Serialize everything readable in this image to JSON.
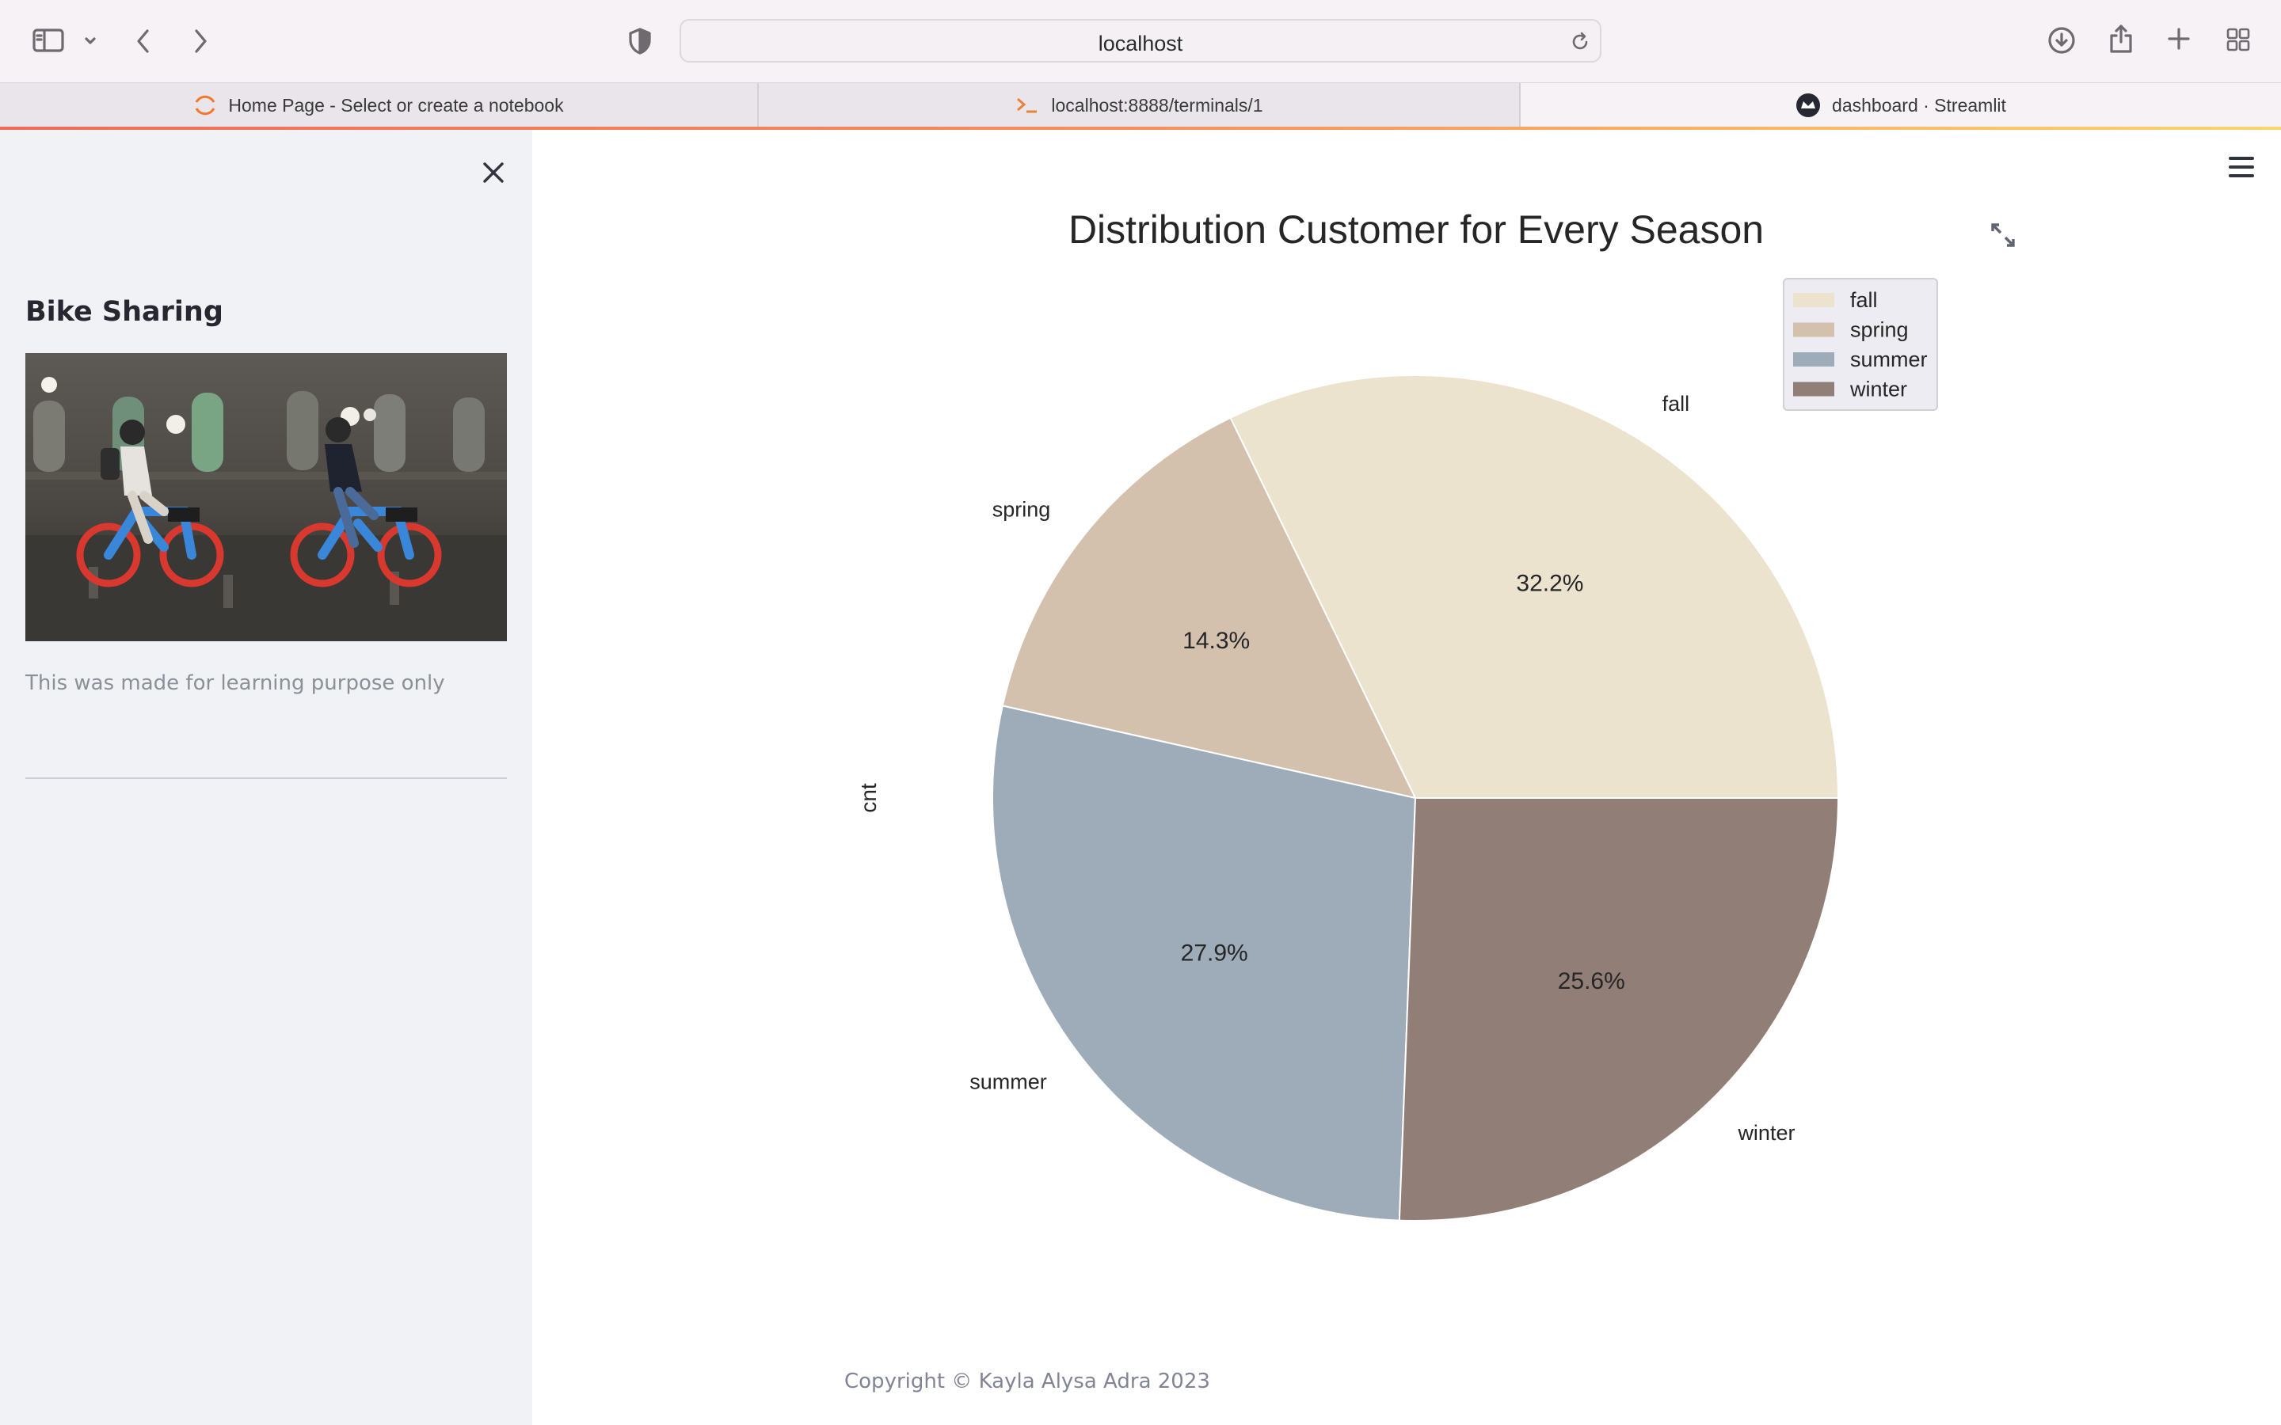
{
  "browser": {
    "address": "localhost",
    "tabs": [
      {
        "label": "Home Page - Select or create a notebook",
        "icon": "jupyter-icon"
      },
      {
        "label": "localhost:8888/terminals/1",
        "icon": "terminal-icon"
      },
      {
        "label": "dashboard · Streamlit",
        "icon": "streamlit-icon"
      }
    ]
  },
  "sidebar": {
    "title": "Bike Sharing",
    "image": "bike-sharing-photo",
    "caption": "This was made for learning purpose only"
  },
  "main": {
    "footer": "Copyright © Kayla Alysa Adra 2023"
  },
  "chart_data": {
    "type": "pie",
    "title": "Distribution Customer for Every Season",
    "ylabel": "cnt",
    "categories": [
      "fall",
      "spring",
      "summer",
      "winter"
    ],
    "values": [
      32.2,
      14.3,
      27.9,
      25.6
    ],
    "labels": [
      "32.2%",
      "14.3%",
      "27.9%",
      "25.6%"
    ],
    "colors": [
      "#ebe3cd",
      "#d3c1ae",
      "#9eabb8",
      "#917f77"
    ],
    "legend": "top-right"
  }
}
